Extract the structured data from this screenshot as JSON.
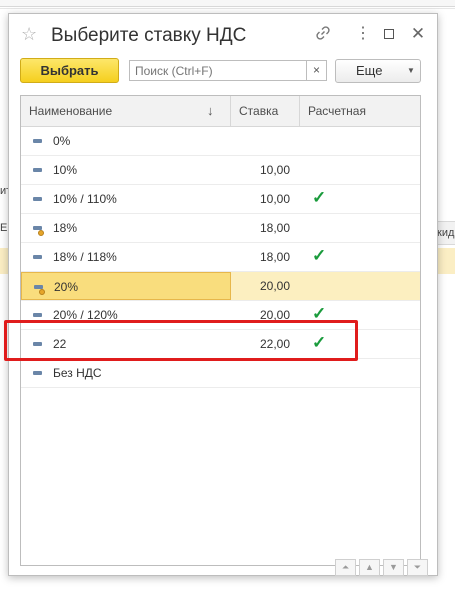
{
  "background": {
    "left_partial_1": "ит",
    "left_partial_2": "Е",
    "right_partial_header": "кид"
  },
  "dialog": {
    "title": "Выберите ставку НДС",
    "icons": {
      "favorite": "star-icon",
      "link": "link-icon",
      "more": "more-vertical-icon",
      "maximize": "maximize-icon",
      "close": "close-icon"
    }
  },
  "toolbar": {
    "select_label": "Выбрать",
    "search_placeholder": "Поиск (Ctrl+F)",
    "search_value": "",
    "clear_label": "×",
    "more_label": "Еще",
    "more_caret": "▼"
  },
  "table": {
    "columns": [
      "Наименование",
      "Ставка",
      "Расчетная"
    ],
    "sort_indicator": "↓",
    "rows": [
      {
        "name": "0%",
        "rate": "",
        "calculated": false,
        "icon": "item-icon",
        "selected": false
      },
      {
        "name": "10%",
        "rate": "10,00",
        "calculated": false,
        "icon": "item-icon",
        "selected": false
      },
      {
        "name": "10% / 110%",
        "rate": "10,00",
        "calculated": true,
        "icon": "item-icon",
        "selected": false
      },
      {
        "name": "18%",
        "rate": "18,00",
        "calculated": false,
        "icon": "item-marked-icon",
        "selected": false
      },
      {
        "name": "18% / 118%",
        "rate": "18,00",
        "calculated": true,
        "icon": "item-icon",
        "selected": false
      },
      {
        "name": "20%",
        "rate": "20,00",
        "calculated": false,
        "icon": "item-marked-icon",
        "selected": true
      },
      {
        "name": "20% / 120%",
        "rate": "20,00",
        "calculated": true,
        "icon": "item-icon",
        "selected": false
      },
      {
        "name": "22",
        "rate": "22,00",
        "calculated": true,
        "icon": "item-icon",
        "selected": false
      },
      {
        "name": "Без НДС",
        "rate": "",
        "calculated": false,
        "icon": "item-icon",
        "selected": false
      }
    ],
    "check_symbol": "✓"
  },
  "navigation": {
    "first": "⏶",
    "prev": "▲",
    "next": "▼",
    "last": "⏷"
  },
  "colors": {
    "accent_button": "#f5cf1e",
    "selected_row": "#fcefc0",
    "check": "#1a9b3c",
    "highlight": "#e01c1c"
  }
}
